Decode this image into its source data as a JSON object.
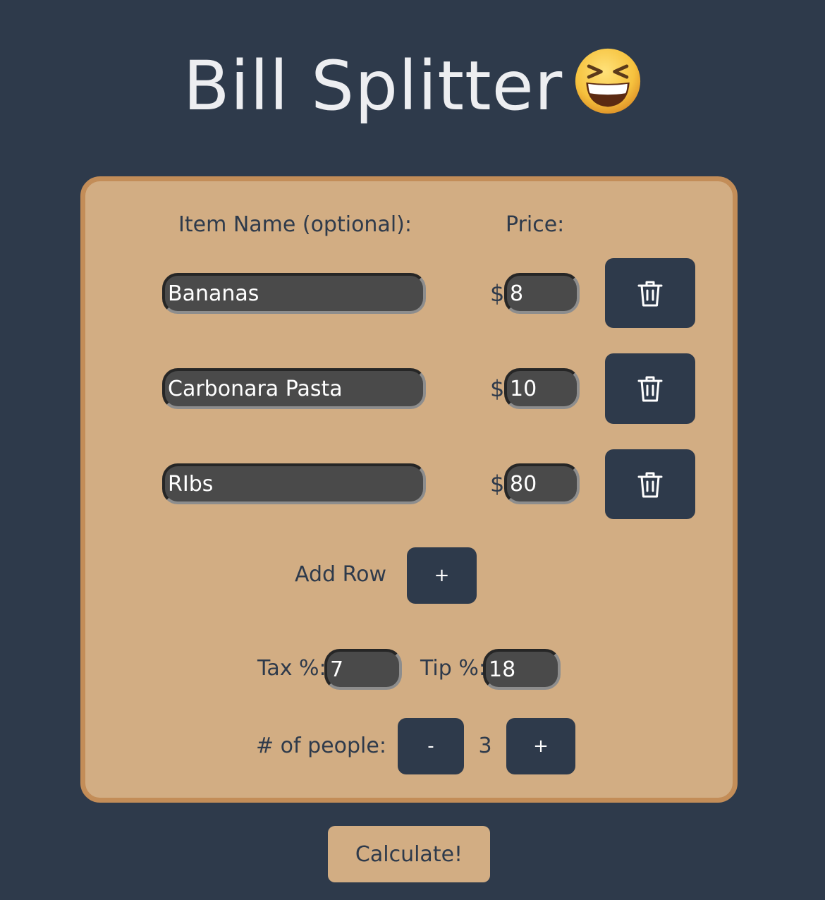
{
  "header": {
    "title": "Bill Splitter",
    "emoji": "grinning-squinting-face-icon"
  },
  "table": {
    "item_header": "Item Name (optional):",
    "price_header": "Price:",
    "currency_symbol": "$",
    "rows": [
      {
        "name": "Bananas",
        "price": "8"
      },
      {
        "name": "Carbonara Pasta",
        "price": "10"
      },
      {
        "name": "RIbs",
        "price": "80"
      }
    ]
  },
  "add_row": {
    "label": "Add Row",
    "button": "+"
  },
  "rates": {
    "tax_label": "Tax %:",
    "tax_value": "7",
    "tip_label": "Tip %:",
    "tip_value": "18"
  },
  "people": {
    "label": "# of people:",
    "decrement": "-",
    "count": "3",
    "increment": "+"
  },
  "calculate_label": "Calculate!",
  "colors": {
    "background": "#2e3a4b",
    "card": "#d2ad83",
    "card_border": "#c38d58",
    "input": "#4a4a4a",
    "button": "#2e3a4b"
  }
}
